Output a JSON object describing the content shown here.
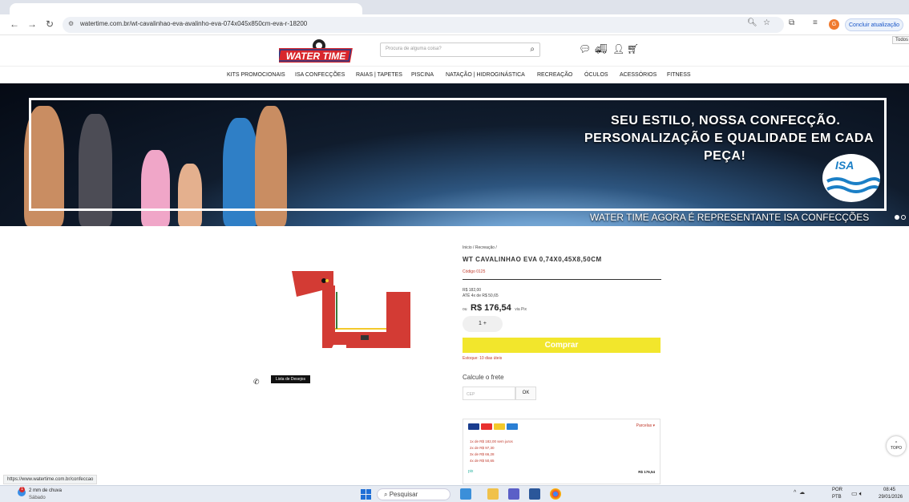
{
  "browser": {
    "url": "watertime.com.br/wt-cavalinhao-eva-avalinho-eva-074x045x850cm-eva-r-18200",
    "update_label": "Concluir atualização",
    "profile_initial": "G",
    "todos_label": "Todos",
    "status_url": "https://www.watertime.com.br/confeccao"
  },
  "header": {
    "logo_text": "WATER TIME",
    "search_placeholder": "Procura de alguma coisa?"
  },
  "menu": [
    "KITS PROMOCIONAIS",
    "ISA CONFECÇÕES",
    "RAIAS | TAPETES",
    "PISCINA",
    "NATAÇÃO | HIDROGINÁSTICA",
    "RECREAÇÃO",
    "ÓCULOS",
    "ACESSÓRIOS",
    "FITNESS"
  ],
  "banner": {
    "line1": "SEU ESTILO, NOSSA CONFECÇÃO.",
    "line2": "PERSONALIZAÇÃO E QUALIDADE EM CADA",
    "line3": "PEÇA!",
    "footer": "WATER TIME AGORA É REPRESENTANTE ISA CONFECÇÕES",
    "logo_text": "ISA"
  },
  "product": {
    "breadcrumb": "Inicio / Recreação /",
    "title": "WT CAVALINHAO EVA 0,74X0,45X8,50CM",
    "code": "Código 0125",
    "old_price": "R$ 182,00",
    "installments": "ATÉ 4x de R$ 50,65",
    "price_prefix": "ou",
    "price": "R$ 176,54",
    "price_suffix": "via Pix",
    "quantity": "1",
    "buy_label": "Comprar",
    "stock": "Estoque: 10 dias úteis",
    "freight_label": "Calcule o frete",
    "cep_placeholder": "CEP",
    "ok_label": "OK",
    "wishlist_label": "Lista de Desejos",
    "payment": {
      "see_more": "Parcelas ▾",
      "rows": [
        "1x de R$ 182,00 sem juros",
        "2x de R$ 97,30",
        "3x de R$ 66,28",
        "4x de R$ 50,65"
      ],
      "pix_label": "pix",
      "pix_price": "R$ 176,54"
    }
  },
  "topo_label": "TOPO",
  "taskbar": {
    "weather": "2 mm de chuva",
    "weather_day": "Sábado",
    "search": "Pesquisar",
    "lang1": "POR",
    "lang2": "PTB",
    "time": "08:45",
    "date": "29/01/2026"
  }
}
